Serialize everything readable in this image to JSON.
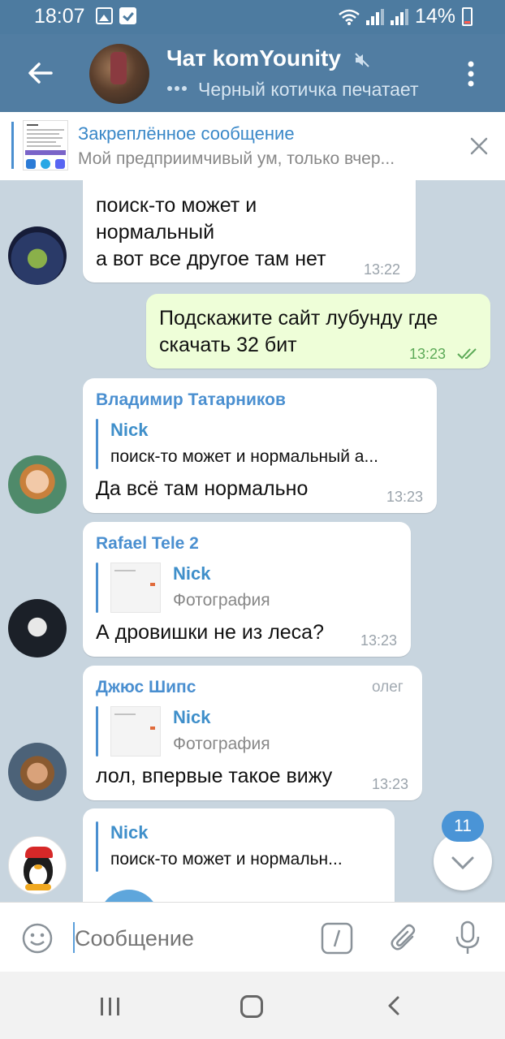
{
  "status_bar": {
    "time": "18:07",
    "battery": "14%"
  },
  "header": {
    "title": "Чат komYounity",
    "typing": "Черный котичка печатает"
  },
  "pinned": {
    "title": "Закреплённое сообщение",
    "text": "Мой предприимчивый ум, только вчер..."
  },
  "messages": {
    "m1": {
      "lines": [
        "поиск-то может и",
        "нормальный",
        "а вот все другое там нет"
      ],
      "time": "13:22"
    },
    "m2": {
      "lines": [
        "Подскажите сайт лубунду где",
        "скачать 32 бит"
      ],
      "time": "13:23"
    },
    "m3": {
      "sender": "Владимир Татарников",
      "sender_color": "#4a8fd0",
      "reply_name": "Nick",
      "reply_text": "поиск-то может и нормальный а...",
      "text": "Да всё там нормально",
      "time": "13:23"
    },
    "m4": {
      "sender": "Rafael Tele 2",
      "sender_color": "#4a8fd0",
      "reply_name": "Nick",
      "reply_text": "Фотография",
      "text": "А дровишки не из леса?",
      "time": "13:23"
    },
    "m5": {
      "sender": "Джюс Шипс",
      "sender_color": "#4a8fd0",
      "tag": "олег",
      "reply_name": "Nick",
      "reply_text": "Фотография",
      "text": "лол, впервые такое вижу",
      "time": "13:23"
    },
    "m6": {
      "reply_name": "Nick",
      "reply_text": "поиск-то может и нормальн..."
    }
  },
  "unread_count": "11",
  "input": {
    "placeholder": "Сообщение"
  },
  "colors": {
    "header": "#517da2",
    "status_bar": "#4d7ba0",
    "accent": "#4a8fd0",
    "outgoing_bubble": "#eefed8",
    "chat_bg": "#c8d5df"
  }
}
